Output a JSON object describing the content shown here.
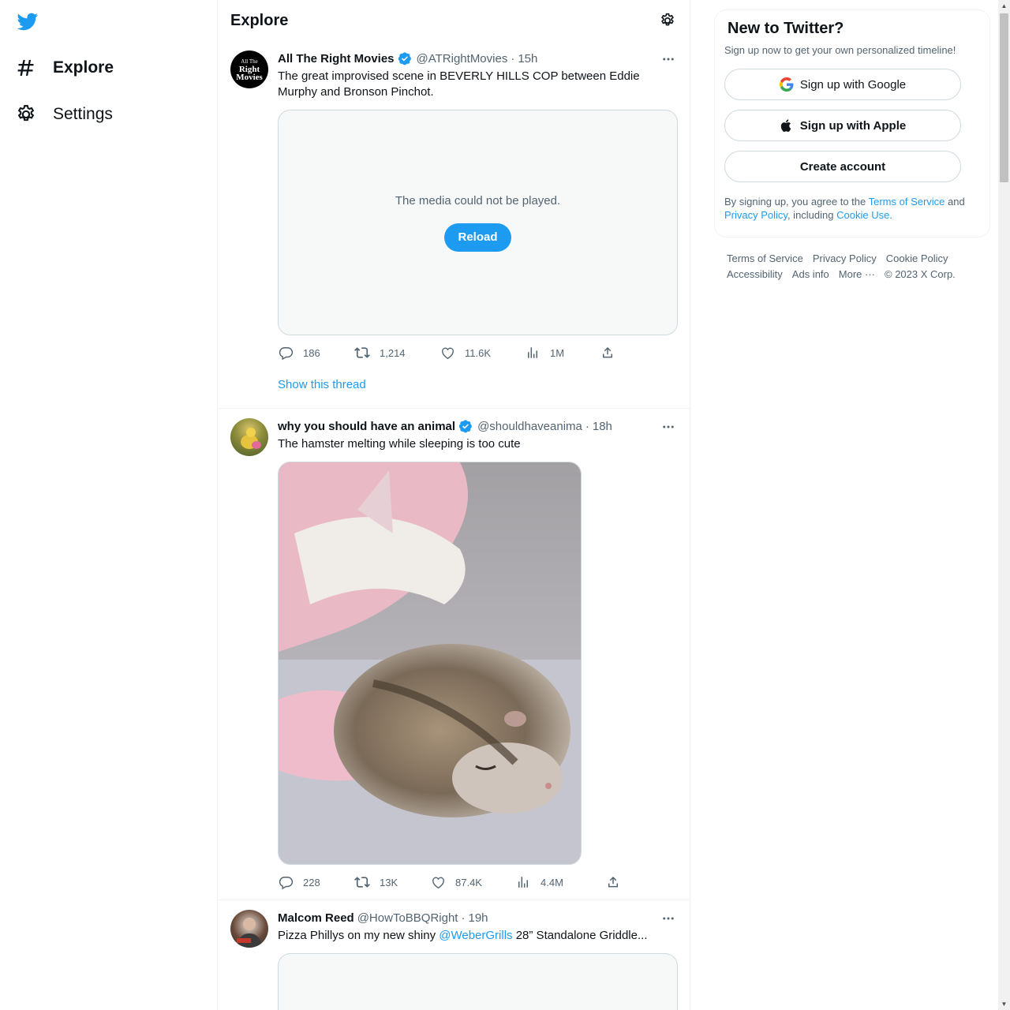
{
  "nav": {
    "logo": "twitter-logo",
    "items": [
      {
        "label": "Explore",
        "icon": "hashtag-icon"
      },
      {
        "label": "Settings",
        "icon": "gear-icon"
      }
    ]
  },
  "header": {
    "title": "Explore"
  },
  "tweets": [
    {
      "name": "All The Right Movies",
      "handle": "@ATRightMovies",
      "time": "15h",
      "verified": true,
      "avatar_text": [
        "All The",
        "Right",
        "Movies"
      ],
      "text": "The great improvised scene in BEVERLY HILLS COP between Eddie Murphy and Bronson Pinchot.",
      "media_error": "The media could not be played.",
      "reload_label": "Reload",
      "stats": {
        "replies": "186",
        "retweets": "1,214",
        "likes": "11.6K",
        "views": "1M"
      },
      "show_thread": "Show this thread"
    },
    {
      "name": "why you should have an animal",
      "handle": "@shouldhaveanima",
      "time": "18h",
      "verified": true,
      "text": "The hamster melting while sleeping is too cute",
      "stats": {
        "replies": "228",
        "retweets": "13K",
        "likes": "87.4K",
        "views": "4.4M"
      }
    },
    {
      "name": "Malcom Reed",
      "handle": "@HowToBBQRight",
      "time": "19h",
      "verified": false,
      "text_before": "Pizza Phillys on my new shiny ",
      "mention": "@WeberGrills",
      "text_after": " 28” Standalone Griddle..."
    }
  ],
  "signup": {
    "title": "New to Twitter?",
    "subtitle": "Sign up now to get your own personalized timeline!",
    "google": "Sign up with Google",
    "apple": "Sign up with Apple",
    "create": "Create account",
    "legal_1": "By signing up, you agree to the ",
    "terms": "Terms of Service",
    "legal_2": " and ",
    "privacy": "Privacy Policy",
    "legal_3": ", including ",
    "cookie": "Cookie Use."
  },
  "footer": {
    "links": [
      "Terms of Service",
      "Privacy Policy",
      "Cookie Policy",
      "Accessibility",
      "Ads info",
      "More ···"
    ],
    "copyright": "© 2023 X Corp."
  },
  "colors": {
    "accent": "#1d9bf0",
    "secondary_text": "#536471",
    "border": "#eff3f4"
  }
}
